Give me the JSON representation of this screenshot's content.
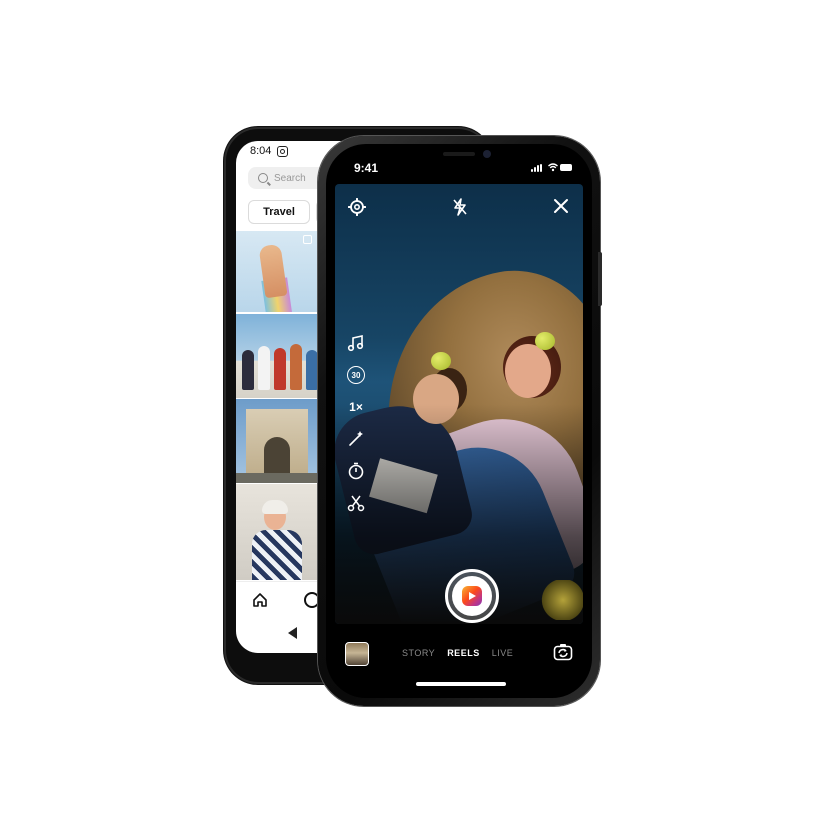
{
  "android": {
    "time": "8:04",
    "search_placeholder": "Search",
    "chip_label": "Travel"
  },
  "iphone": {
    "time": "9:41",
    "tools": {
      "timer_label": "30",
      "speed_label": "1×"
    },
    "modes": [
      {
        "label": "STORY",
        "active": false
      },
      {
        "label": "REELS",
        "active": true
      },
      {
        "label": "LIVE",
        "active": false
      }
    ]
  },
  "colors": {
    "reels_gradient": [
      "#f7b733",
      "#fc4a1a",
      "#c13584",
      "#833ab4"
    ],
    "active_mode": "#ffffff",
    "inactive_mode": "#8a8a8a"
  }
}
